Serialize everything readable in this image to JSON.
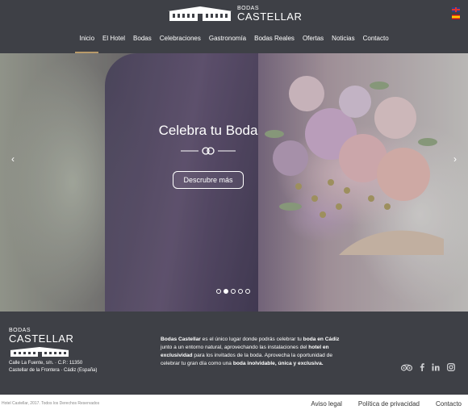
{
  "header": {
    "logo_small": "BODAS",
    "logo_big": "CASTELLAR",
    "nav": [
      {
        "label": "Inicio"
      },
      {
        "label": "El Hotel"
      },
      {
        "label": "Bodas"
      },
      {
        "label": "Celebraciones"
      },
      {
        "label": "Gastronomía"
      },
      {
        "label": "Bodas Reales"
      },
      {
        "label": "Ofertas"
      },
      {
        "label": "Noticias"
      },
      {
        "label": "Contacto"
      }
    ],
    "active_nav": "Inicio",
    "accent": "#b89a6a"
  },
  "hero": {
    "title": "Celebra tu Boda",
    "button": "Descrubre más",
    "slides": 5,
    "active_slide": 2
  },
  "footer": {
    "logo_small": "BODAS",
    "logo_big": "CASTELLAR",
    "address_line1": "Calle La Fuente, s/n.  ·  C.P.: 11350",
    "address_line2": "Castellar de la Frontera  ·  Cádiz (España)",
    "desc": {
      "p1": "Bodas Castellar",
      "p2": " es el único lugar donde podrás celebrar tu ",
      "p3": "boda en Cádiz",
      "p4": " junto a un entorno natural, aprovechando las instalaciones del ",
      "p5": "hotel en exclusividad",
      "p6": " para los invitados de la boda. Aprovecha la oportunidad de celebrar tu gran día como una ",
      "p7": "boda inolvidable, única y exclusiva.",
      "p8": ""
    },
    "social": [
      "tripadvisor-icon",
      "facebook-icon",
      "linkedin-icon",
      "instagram-icon"
    ],
    "bg_color": "#3e4046"
  },
  "bottom": {
    "copyright": "Hotel Castellar, 2017. Todos los Derechos Reservados",
    "links": [
      "Aviso legal",
      "Política de privacidad",
      "Contacto"
    ]
  }
}
